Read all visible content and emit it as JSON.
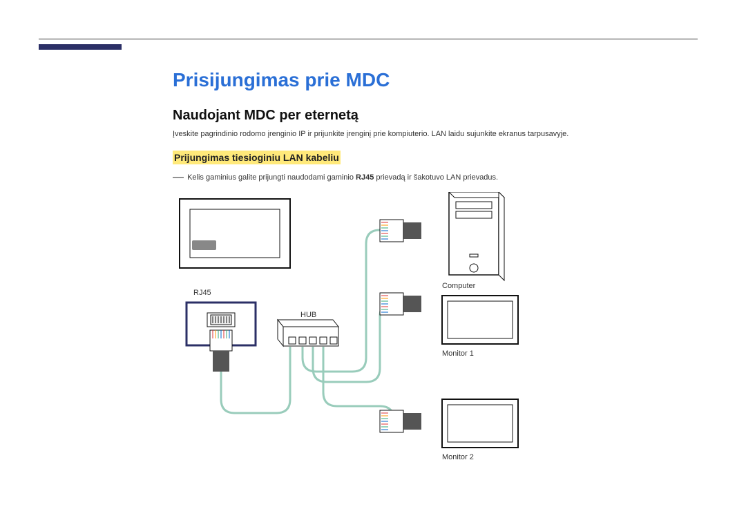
{
  "title": "Prisijungimas prie MDC",
  "subtitle": "Naudojant MDC per eternetą",
  "body": "Įveskite pagrindinio rodomo įrenginio IP ir prijunkite įrenginį prie kompiuterio. LAN laidu sujunkite ekranus tarpusavyje.",
  "section_label": "Prijungimas tiesioginiu LAN kabeliu",
  "note_prefix": "Kelis gaminius galite prijungti naudodami gaminio ",
  "note_bold": "RJ45",
  "note_suffix": " prievadą ir šakotuvo LAN prievadus.",
  "labels": {
    "rj45": "RJ45",
    "hub": "HUB",
    "computer": "Computer",
    "monitor1": "Monitor 1",
    "monitor2": "Monitor 2"
  }
}
